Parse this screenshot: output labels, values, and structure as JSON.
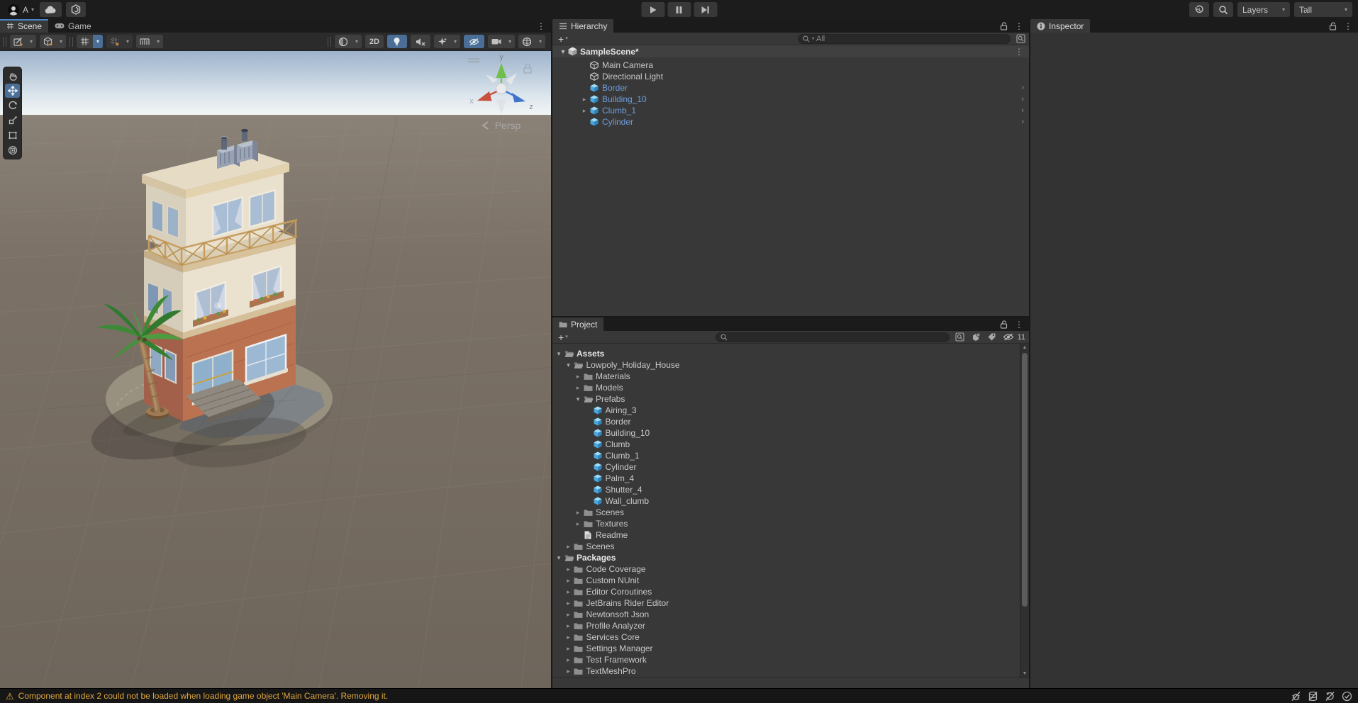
{
  "main_toolbar": {
    "account_initial": "A",
    "play_controls": [
      "play",
      "pause",
      "step"
    ],
    "layers_label": "Layers",
    "layout_label": "Tall"
  },
  "scene_view": {
    "tabs": [
      {
        "label": "Scene",
        "icon": "grid-icon",
        "active": true
      },
      {
        "label": "Game",
        "icon": "gamepad-icon",
        "active": false
      }
    ],
    "toolbar": {
      "mode_2d_label": "2D"
    },
    "tools": [
      "view-hand",
      "move",
      "rotate",
      "scale",
      "rect",
      "transform"
    ],
    "active_tool": "move",
    "orientation_gizmo": {
      "axis_labels": {
        "x": "x",
        "y": "y",
        "z": "z"
      },
      "projection_label": "Persp"
    }
  },
  "hierarchy": {
    "tab_label": "Hierarchy",
    "create_label": "+",
    "search_placeholder": "All",
    "scene": {
      "name": "SampleScene*"
    },
    "items": [
      {
        "label": "Main Camera",
        "icon": "gameobject"
      },
      {
        "label": "Directional Light",
        "icon": "gameobject"
      },
      {
        "label": "Border",
        "icon": "prefab",
        "prefab": true,
        "open_chevron": true
      },
      {
        "label": "Building_10",
        "icon": "prefab",
        "prefab": true,
        "expand": "collapsed",
        "open_chevron": true
      },
      {
        "label": "Clumb_1",
        "icon": "prefab",
        "prefab": true,
        "expand": "collapsed",
        "open_chevron": true
      },
      {
        "label": "Cylinder",
        "icon": "prefab",
        "prefab": true,
        "open_chevron": true
      }
    ]
  },
  "project": {
    "tab_label": "Project",
    "create_label": "+",
    "search_placeholder": "",
    "hidden_count": "11",
    "tree": [
      {
        "label": "Assets",
        "level": 0,
        "icon": "folder-open",
        "expand": "expanded",
        "bold": true
      },
      {
        "label": "Lowpoly_Holiday_House",
        "level": 1,
        "icon": "folder-open",
        "expand": "expanded"
      },
      {
        "label": "Materials",
        "level": 2,
        "icon": "folder",
        "expand": "collapsed"
      },
      {
        "label": "Models",
        "level": 2,
        "icon": "folder",
        "expand": "collapsed"
      },
      {
        "label": "Prefabs",
        "level": 2,
        "icon": "folder-open",
        "expand": "expanded"
      },
      {
        "label": "Airing_3",
        "level": 3,
        "icon": "prefab"
      },
      {
        "label": "Border",
        "level": 3,
        "icon": "prefab"
      },
      {
        "label": "Building_10",
        "level": 3,
        "icon": "prefab"
      },
      {
        "label": "Clumb",
        "level": 3,
        "icon": "prefab"
      },
      {
        "label": "Clumb_1",
        "level": 3,
        "icon": "prefab"
      },
      {
        "label": "Cylinder",
        "level": 3,
        "icon": "prefab"
      },
      {
        "label": "Palm_4",
        "level": 3,
        "icon": "prefab"
      },
      {
        "label": "Shutter_4",
        "level": 3,
        "icon": "prefab"
      },
      {
        "label": "Wall_clumb",
        "level": 3,
        "icon": "prefab"
      },
      {
        "label": "Scenes",
        "level": 2,
        "icon": "folder",
        "expand": "collapsed"
      },
      {
        "label": "Textures",
        "level": 2,
        "icon": "folder",
        "expand": "collapsed"
      },
      {
        "label": "Readme",
        "level": 2,
        "icon": "document"
      },
      {
        "label": "Scenes",
        "level": 1,
        "icon": "folder",
        "expand": "collapsed"
      },
      {
        "label": "Packages",
        "level": 0,
        "icon": "folder-open",
        "expand": "expanded",
        "bold": true
      },
      {
        "label": "Code Coverage",
        "level": 1,
        "icon": "folder",
        "expand": "collapsed"
      },
      {
        "label": "Custom NUnit",
        "level": 1,
        "icon": "folder",
        "expand": "collapsed"
      },
      {
        "label": "Editor Coroutines",
        "level": 1,
        "icon": "folder",
        "expand": "collapsed"
      },
      {
        "label": "JetBrains Rider Editor",
        "level": 1,
        "icon": "folder",
        "expand": "collapsed"
      },
      {
        "label": "Newtonsoft Json",
        "level": 1,
        "icon": "folder",
        "expand": "collapsed"
      },
      {
        "label": "Profile Analyzer",
        "level": 1,
        "icon": "folder",
        "expand": "collapsed"
      },
      {
        "label": "Services Core",
        "level": 1,
        "icon": "folder",
        "expand": "collapsed"
      },
      {
        "label": "Settings Manager",
        "level": 1,
        "icon": "folder",
        "expand": "collapsed"
      },
      {
        "label": "Test Framework",
        "level": 1,
        "icon": "folder",
        "expand": "collapsed"
      },
      {
        "label": "TextMeshPro",
        "level": 1,
        "icon": "folder",
        "expand": "collapsed"
      }
    ]
  },
  "inspector": {
    "tab_label": "Inspector"
  },
  "status_bar": {
    "message": "Component at index 2 could not be loaded when loading game object 'Main Camera'. Removing it.",
    "icons": [
      "debugger-disabled",
      "cache-disabled",
      "auto-refresh-disabled",
      "progress-idle"
    ]
  },
  "colors": {
    "accent_blue": "#4c84c4",
    "toggle_blue": "#4a6e96",
    "prefab_text": "#6d9ede",
    "prefab_icon": "#4da7dd",
    "warning_text": "#dfa63d",
    "panel_bg": "#383838",
    "chrome_bg": "#1c1c1c"
  }
}
